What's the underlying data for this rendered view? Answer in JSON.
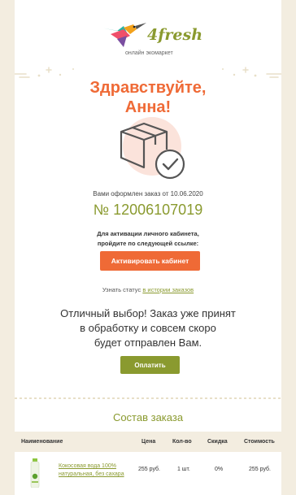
{
  "brand": {
    "name": "4fresh",
    "tagline": "онлайн экомаркет",
    "colors": {
      "orange": "#ef6a36",
      "green": "#8a9a2f",
      "beige": "#f3ede0"
    }
  },
  "greeting": {
    "line1": "Здравствуйте,",
    "line2": "Анна!"
  },
  "order": {
    "date_text": "Вами оформлен заказ от 10.06.2020",
    "number": "№ 12006107019"
  },
  "activation": {
    "line1": "Для активации личного кабинета,",
    "line2": "пройдите по следующей ссылке:",
    "button": "Активировать кабинет"
  },
  "status": {
    "prefix": "Узнать статус",
    "link": "в истории заказов"
  },
  "message": {
    "line1": "Отличный выбор! Заказ уже принят",
    "line2": "в обработку и совсем скоро",
    "line3": "будет отправлен Вам."
  },
  "pay_button": "Оплатить",
  "order_contents": {
    "title": "Состав заказа",
    "columns": [
      "Наименование",
      "Цена",
      "Кол-во",
      "Скидка",
      "Стоимость"
    ],
    "rows": [
      {
        "name_line1": "Кокосовая вода 100%",
        "name_line2": "натуральная, без сахара",
        "price": "255 руб.",
        "qty": "1 шт.",
        "discount": "0%",
        "total": "255 руб."
      }
    ]
  },
  "icons": [
    "hummingbird-logo-icon",
    "box-check-icon"
  ]
}
